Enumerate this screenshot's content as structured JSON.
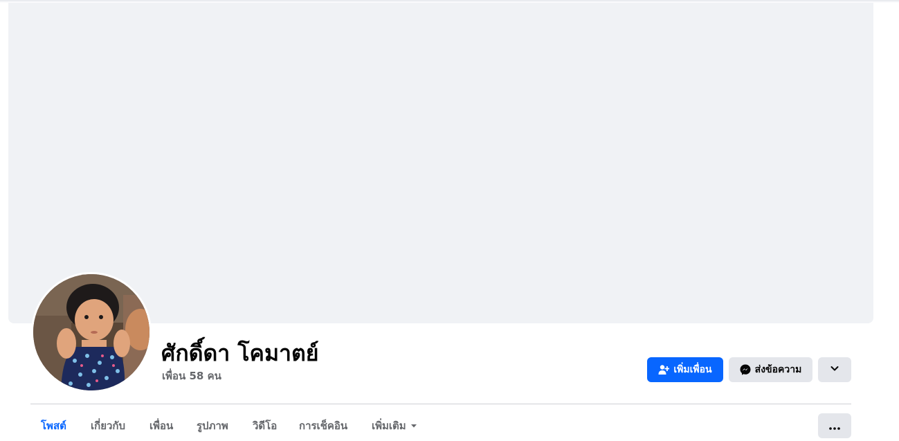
{
  "profile": {
    "name": "ศักดิ์ดา โคมาตย์",
    "friends_count": "เพื่อน 58 คน"
  },
  "actions": {
    "add_friend_label": "เพิ่มเพื่อน",
    "message_label": "ส่งข้อความ"
  },
  "tabs": [
    {
      "label": "โพสต์",
      "active": true
    },
    {
      "label": "เกี่ยวกับ",
      "active": false
    },
    {
      "label": "เพื่อน",
      "active": false
    },
    {
      "label": "รูปภาพ",
      "active": false
    },
    {
      "label": "วิดีโอ",
      "active": false
    },
    {
      "label": "การเช็คอิน",
      "active": false
    },
    {
      "label": "เพิ่มเติม",
      "active": false
    }
  ],
  "icons": {
    "add_friend": "person-plus-icon",
    "message": "messenger-icon",
    "more_dropdown": "chevron-down-icon",
    "tab_more": "caret-down-icon",
    "options": "ellipsis-icon"
  },
  "colors": {
    "accent": "#0866ff",
    "cover": "#f0f2f5",
    "secondary_button": "#e4e6eb",
    "muted_text": "#65676b"
  }
}
